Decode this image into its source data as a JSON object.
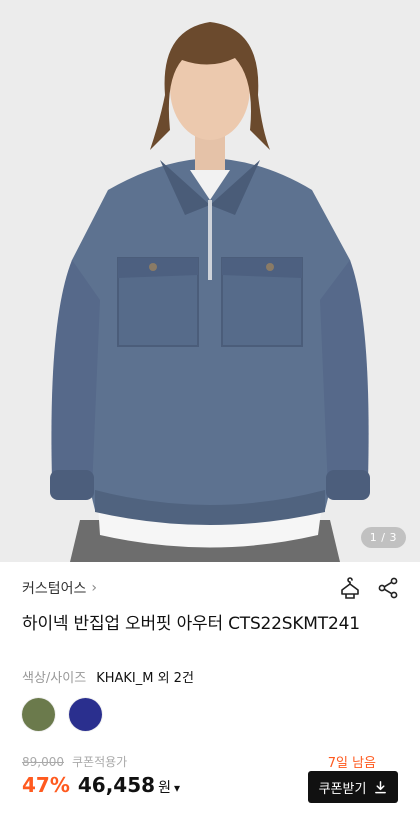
{
  "hero": {
    "pager": "1 / 3",
    "alt": "man wearing blue-gray half-zip sweatshirt"
  },
  "product": {
    "brand": "커스텀어스",
    "brand_chevron": "›",
    "title": "하이넥 반집업 오버핏 아우터 CTS22SKMT241"
  },
  "actions": {
    "closet_icon": "hanger-icon",
    "share_icon": "share-icon"
  },
  "options": {
    "label": "색상/사이즈",
    "value": "KHAKI_M 외 2건",
    "swatches": [
      "#6b7a4c",
      "#2a2f8e"
    ]
  },
  "pricing": {
    "original_price": "89,000",
    "coupon_label": "쿠폰적용가",
    "days_left": "7일 남음",
    "discount": "47%",
    "price": "46,458",
    "currency": "원",
    "coupon_button": "쿠폰받기"
  },
  "colors": {
    "accent": "#ff5a1f",
    "button_bg": "#111111"
  }
}
